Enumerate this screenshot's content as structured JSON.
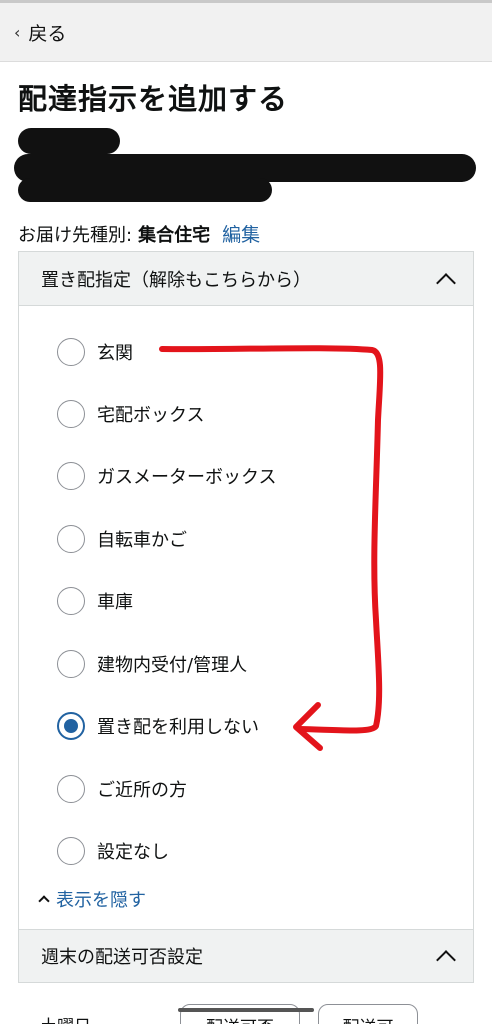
{
  "header": {
    "back_label": "戻る"
  },
  "page_title": "配達指示を追加する",
  "destination": {
    "type_label": "お届け先種別:",
    "type_value": "集合住宅",
    "edit_label": "編集"
  },
  "safe_place": {
    "section_title": "置き配指定（解除もこちらから）",
    "options": [
      {
        "label": "玄関",
        "selected": false
      },
      {
        "label": "宅配ボックス",
        "selected": false
      },
      {
        "label": "ガスメーターボックス",
        "selected": false
      },
      {
        "label": "自転車かご",
        "selected": false
      },
      {
        "label": "車庫",
        "selected": false
      },
      {
        "label": "建物内受付/管理人",
        "selected": false
      },
      {
        "label": "置き配を利用しない",
        "selected": true
      },
      {
        "label": "ご近所の方",
        "selected": false
      },
      {
        "label": "設定なし",
        "selected": false
      }
    ],
    "hide_label": "表示を隠す"
  },
  "weekend": {
    "section_title": "週末の配送可否設定",
    "saturday_label": "土曜日",
    "buttons": [
      "配送可否",
      "配送可"
    ]
  },
  "colors": {
    "link": "#2162a1",
    "annotation": "#e3141b",
    "radio_selected": "#2162a1"
  }
}
